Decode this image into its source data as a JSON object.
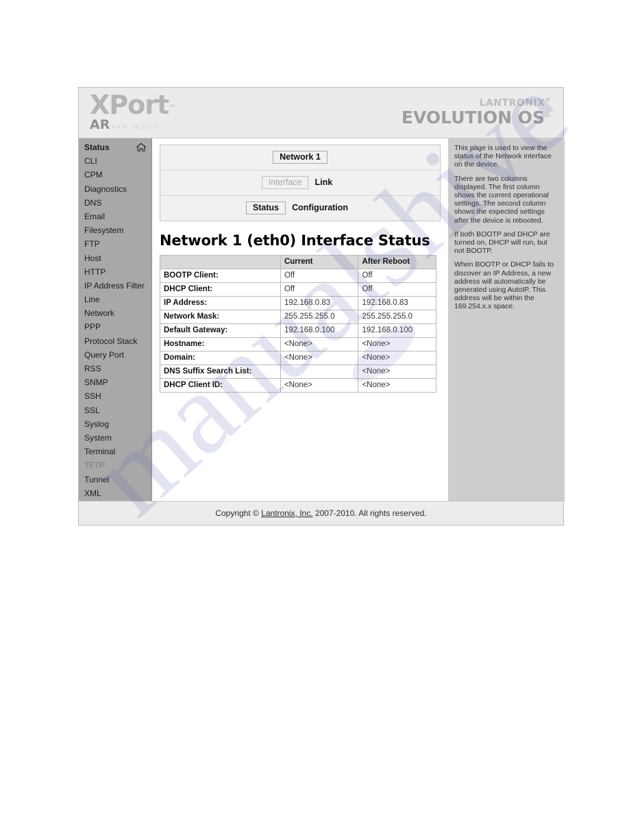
{
  "header": {
    "product_logo": "XPort",
    "product_logo_tm": "™",
    "product_variant": "AR",
    "product_variant_sub": "ARM INSIDE",
    "vendor": "LANTRONIX",
    "vendor_reg": "®",
    "os_name": "EVOLUTION OS",
    "os_tm": "™"
  },
  "sidebar": {
    "items": [
      {
        "label": "Status",
        "icon": "home-icon",
        "active": true
      },
      {
        "label": "CLI"
      },
      {
        "label": "CPM"
      },
      {
        "label": "Diagnostics"
      },
      {
        "label": "DNS"
      },
      {
        "label": "Email"
      },
      {
        "label": "Filesystem"
      },
      {
        "label": "FTP"
      },
      {
        "label": "Host"
      },
      {
        "label": "HTTP"
      },
      {
        "label": "IP Address Filter"
      },
      {
        "label": "Line"
      },
      {
        "label": "Network"
      },
      {
        "label": "PPP"
      },
      {
        "label": "Protocol Stack"
      },
      {
        "label": "Query Port"
      },
      {
        "label": "RSS"
      },
      {
        "label": "SNMP"
      },
      {
        "label": "SSH"
      },
      {
        "label": "SSL"
      },
      {
        "label": "Syslog"
      },
      {
        "label": "System"
      },
      {
        "label": "Terminal"
      },
      {
        "label": "TFTP"
      },
      {
        "label": "Tunnel"
      },
      {
        "label": "XML"
      }
    ]
  },
  "tabs": {
    "row1": [
      {
        "label": "Network 1",
        "style": "box"
      }
    ],
    "row2": [
      {
        "label": "Interface",
        "style": "box-disabled"
      },
      {
        "label": "Link",
        "style": "plain"
      }
    ],
    "row3": [
      {
        "label": "Status",
        "style": "box"
      },
      {
        "label": "Configuration",
        "style": "plain"
      }
    ]
  },
  "main": {
    "heading": "Network 1 (eth0) Interface Status",
    "table": {
      "columns": [
        "",
        "Current",
        "After Reboot"
      ],
      "rows": [
        {
          "label": "BOOTP Client:",
          "current": "Off",
          "after_reboot": "Off"
        },
        {
          "label": "DHCP Client:",
          "current": "Off",
          "after_reboot": "Off"
        },
        {
          "label": "IP Address:",
          "current": "192.168.0.83",
          "after_reboot": "192.168.0.83"
        },
        {
          "label": "Network Mask:",
          "current": "255.255.255.0",
          "after_reboot": "255.255.255.0"
        },
        {
          "label": "Default Gateway:",
          "current": "192.168.0.100",
          "after_reboot": "192.168.0.100"
        },
        {
          "label": "Hostname:",
          "current": "<None>",
          "after_reboot": "<None>"
        },
        {
          "label": "Domain:",
          "current": "<None>",
          "after_reboot": "<None>"
        },
        {
          "label": "DNS Suffix Search List:",
          "current": "",
          "after_reboot": "<None>"
        },
        {
          "label": "DHCP Client ID:",
          "current": "<None>",
          "after_reboot": "<None>"
        }
      ]
    }
  },
  "help": {
    "paragraphs": [
      "This page is used to view the status of the Network interface on the device.",
      "There are two columns displayed. The first column shows the current operational settings. The second column shows the expected settings after the device is rebooted.",
      "If both BOOTP and DHCP are turned on, DHCP will run, but not BOOTP.",
      "When BOOTP or DHCP fails to discover an IP Address, a new address will automatically be generated using AutoIP. This address will be within the 169.254.x.x space."
    ]
  },
  "footer": {
    "prefix": "Copyright © ",
    "link": "Lantronix, Inc.",
    "suffix": " 2007-2010. All rights reserved."
  },
  "watermark": {
    "text": "manualshive.com"
  },
  "colors": {
    "sidebar_bg": "#a8a8a8",
    "help_bg": "#cdcdcd",
    "header_bg": "#ebebeb",
    "table_header_bg": "#d9d9d9"
  }
}
